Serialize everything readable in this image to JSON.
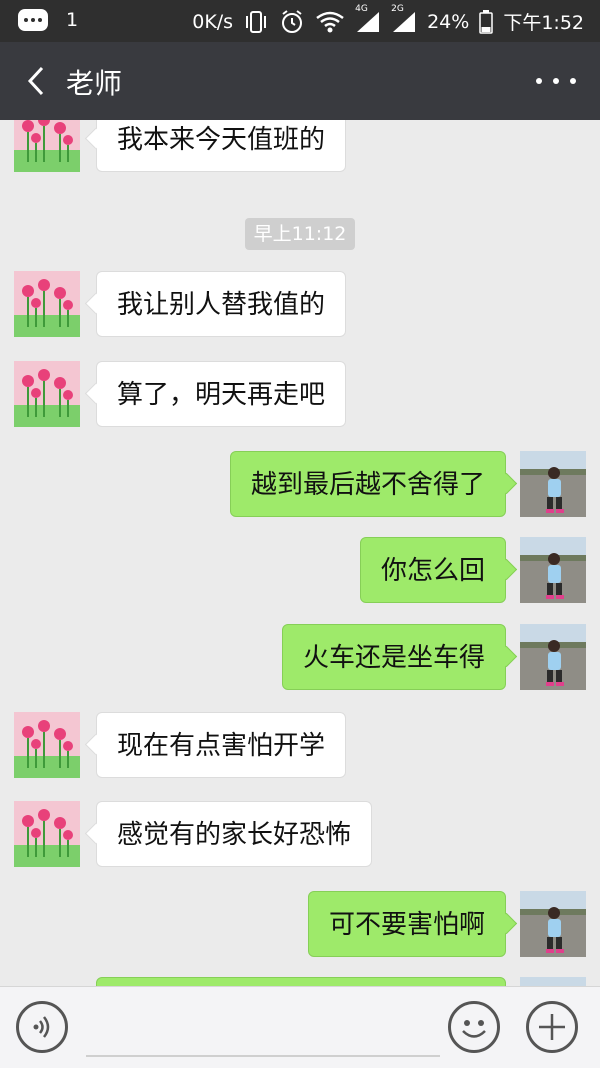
{
  "status_bar": {
    "notification_count": "1",
    "network_speed": "0K/s",
    "net_4g": "4G",
    "net_2g": "2G",
    "battery": "24%",
    "time": "下午1:52"
  },
  "header": {
    "title": "老师"
  },
  "timestamp": "早上11:12",
  "messages": [
    {
      "side": "in",
      "text": "我本来今天值班的"
    },
    {
      "side": "in",
      "text": "我让别人替我值的"
    },
    {
      "side": "in",
      "text": "算了，明天再走吧"
    },
    {
      "side": "out",
      "text": "越到最后越不舍得了"
    },
    {
      "side": "out",
      "text": "你怎么回"
    },
    {
      "side": "out",
      "text": "火车还是坐车得"
    },
    {
      "side": "in",
      "text": "现在有点害怕开学"
    },
    {
      "side": "in",
      "text": "感觉有的家长好恐怖"
    },
    {
      "side": "out",
      "text": "可不要害怕啊"
    },
    {
      "side": "out",
      "text": ""
    }
  ],
  "input": {
    "value": ""
  },
  "colors": {
    "outgoing_bubble": "#9eea6a",
    "incoming_bubble": "#ffffff",
    "header": "#393a3f",
    "status_bar": "#2f2f2f"
  }
}
